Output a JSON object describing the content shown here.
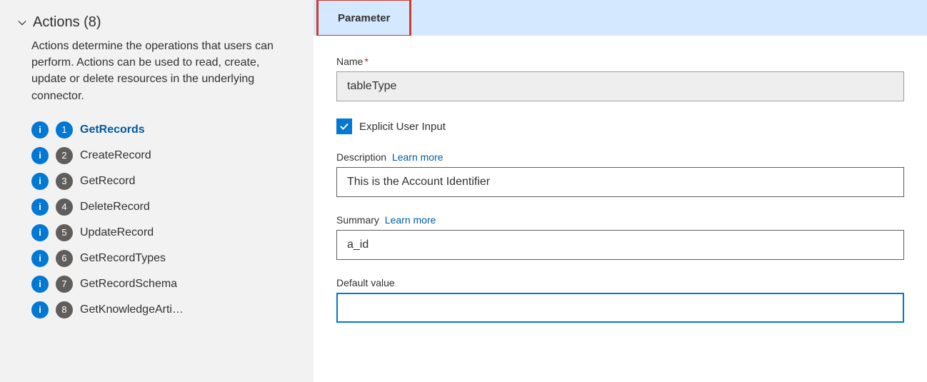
{
  "sidebar": {
    "section_title": "Actions (8)",
    "description": "Actions determine the operations that users can perform. Actions can be used to read, create, update or delete resources in the underlying connector.",
    "items": [
      {
        "num": "1",
        "label": "GetRecords",
        "selected": true
      },
      {
        "num": "2",
        "label": "CreateRecord",
        "selected": false
      },
      {
        "num": "3",
        "label": "GetRecord",
        "selected": false
      },
      {
        "num": "4",
        "label": "DeleteRecord",
        "selected": false
      },
      {
        "num": "5",
        "label": "UpdateRecord",
        "selected": false
      },
      {
        "num": "6",
        "label": "GetRecordTypes",
        "selected": false
      },
      {
        "num": "7",
        "label": "GetRecordSchema",
        "selected": false
      },
      {
        "num": "8",
        "label": "GetKnowledgeArti…",
        "selected": false
      }
    ]
  },
  "main": {
    "tab_label": "Parameter",
    "form": {
      "name_label": "Name",
      "name_value": "tableType",
      "checkbox_label": "Explicit User Input",
      "description_label": "Description",
      "learn_more": "Learn more",
      "description_value": "This is the Account Identifier",
      "summary_label": "Summary",
      "summary_value": "a_id",
      "default_label": "Default value",
      "default_value": ""
    }
  }
}
